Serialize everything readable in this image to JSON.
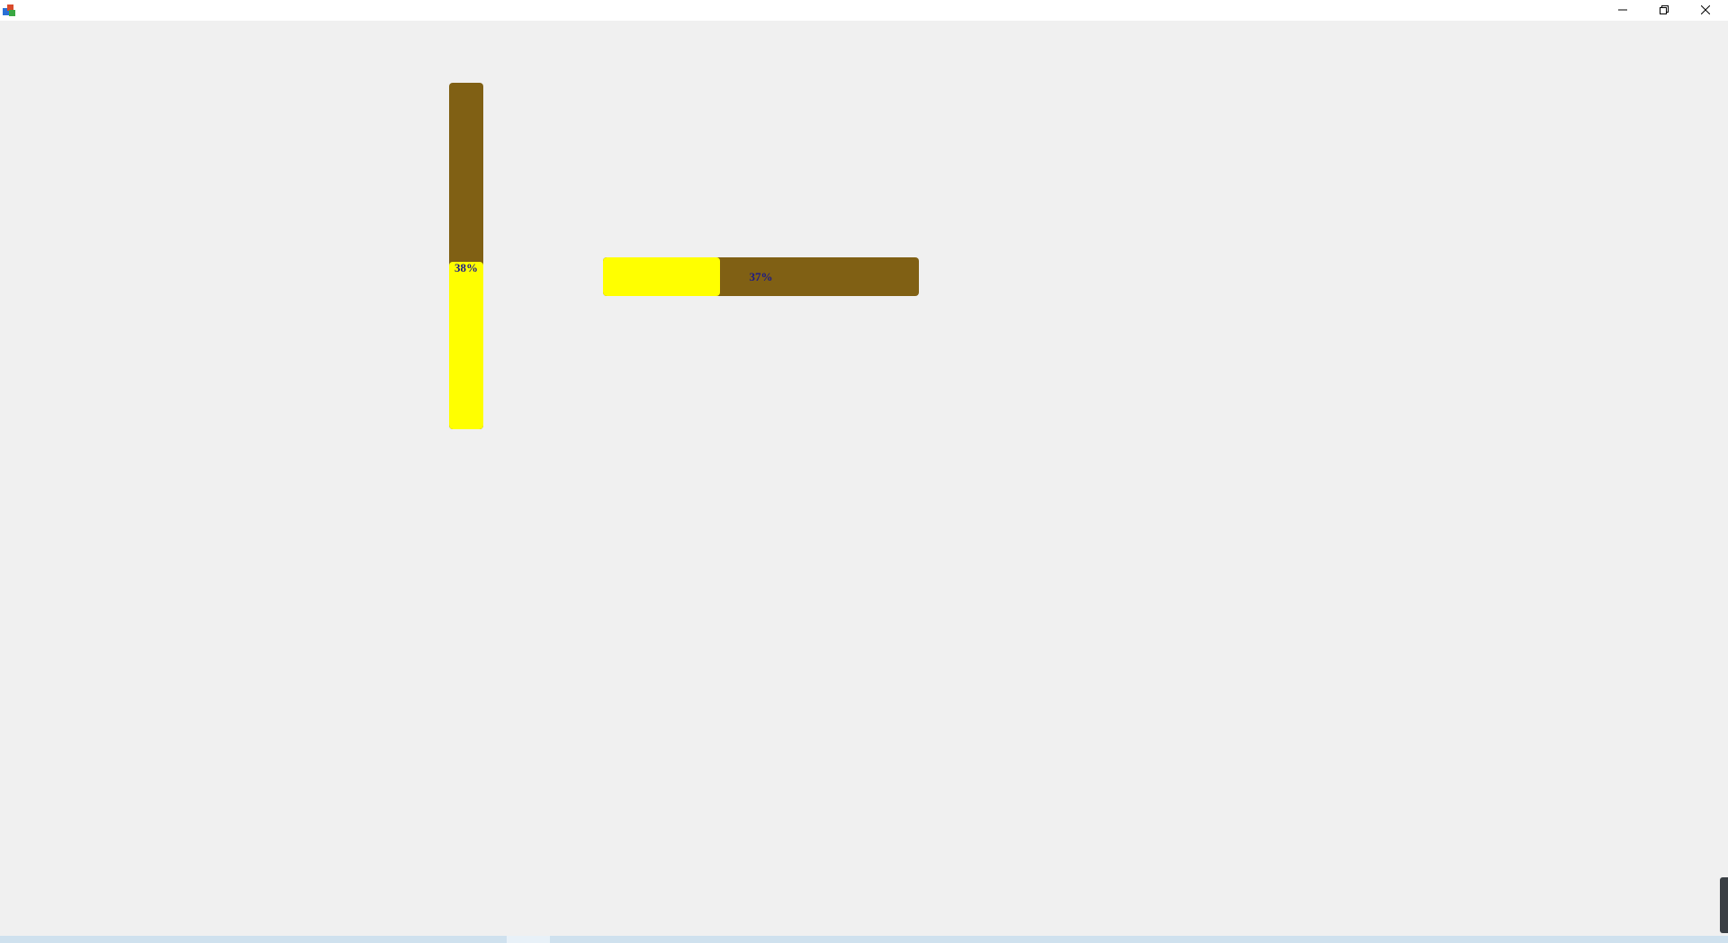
{
  "window": {
    "minimize_icon": "minimize-icon",
    "maximize_icon": "restore-icon",
    "close_icon": "close-icon"
  },
  "vertical_progress": {
    "value": 0.38,
    "label": "38%",
    "track_color": "#806014",
    "fill_color": "#ffff00",
    "text_color": "#1a1a8a"
  },
  "horizontal_progress": {
    "value": 0.37,
    "label": "37%",
    "track_color": "#806014",
    "fill_color": "#ffff00",
    "text_color": "#1a1a8a"
  }
}
